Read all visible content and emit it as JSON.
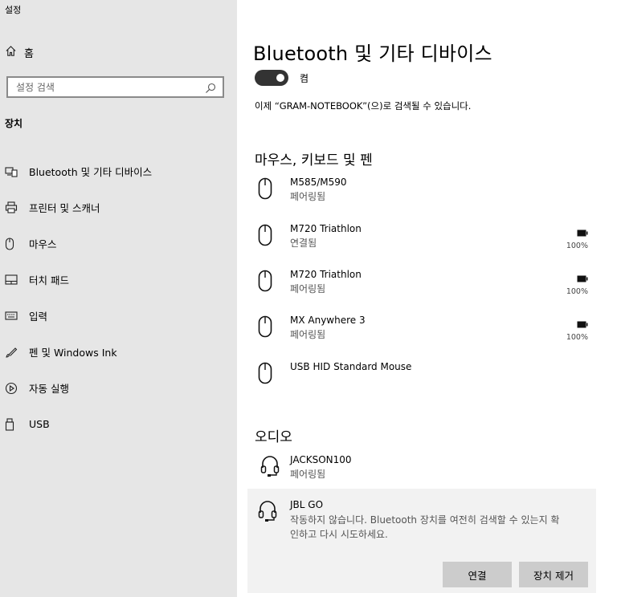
{
  "app": {
    "title": "설정"
  },
  "sidebar": {
    "home_label": "홈",
    "search_placeholder": "설정 검색",
    "section_label": "장치",
    "items": [
      {
        "label": "Bluetooth 및 기타 디바이스",
        "icon": "devices-icon"
      },
      {
        "label": "프린터 및 스캐너",
        "icon": "printer-icon"
      },
      {
        "label": "마우스",
        "icon": "mouse-icon"
      },
      {
        "label": "터치 패드",
        "icon": "touchpad-icon"
      },
      {
        "label": "입력",
        "icon": "keyboard-icon"
      },
      {
        "label": "펜 및 Windows Ink",
        "icon": "pen-icon"
      },
      {
        "label": "자동 실행",
        "icon": "autoplay-icon"
      },
      {
        "label": "USB",
        "icon": "usb-icon"
      }
    ]
  },
  "main": {
    "title": "Bluetooth 및 기타 디바이스",
    "toggle_label": "켬",
    "toggle_on": true,
    "discoverable_text": "이제 “GRAM-NOTEBOOK”(으)로 검색될 수 있습니다.",
    "mice_section": {
      "title": "마우스, 키보드 및 펜",
      "devices": [
        {
          "name": "M585/M590",
          "status": "페어링됨",
          "battery": ""
        },
        {
          "name": "M720 Triathlon",
          "status": "연결됨",
          "battery": "100%"
        },
        {
          "name": "M720 Triathlon",
          "status": "페어링됨",
          "battery": "100%"
        },
        {
          "name": "MX Anywhere 3",
          "status": "페어링됨",
          "battery": "100%"
        },
        {
          "name": "USB HID Standard Mouse",
          "status": "",
          "battery": ""
        }
      ]
    },
    "audio_section": {
      "title": "오디오",
      "devices": [
        {
          "name": "JACKSON100",
          "status": "페어링됨"
        }
      ],
      "selected_device": {
        "name": "JBL GO",
        "description": "작동하지 않습니다. Bluetooth 장치를 여전히 검색할 수 있는지 확인하고 다시 시도하세요.",
        "connect_label": "연결",
        "remove_label": "장치 제거"
      }
    }
  },
  "colors": {
    "sidebar_bg": "#e6e6e6",
    "toggle_on": "#333333",
    "button_bg": "#cccccc",
    "selected_bg": "#f2f2f2"
  }
}
